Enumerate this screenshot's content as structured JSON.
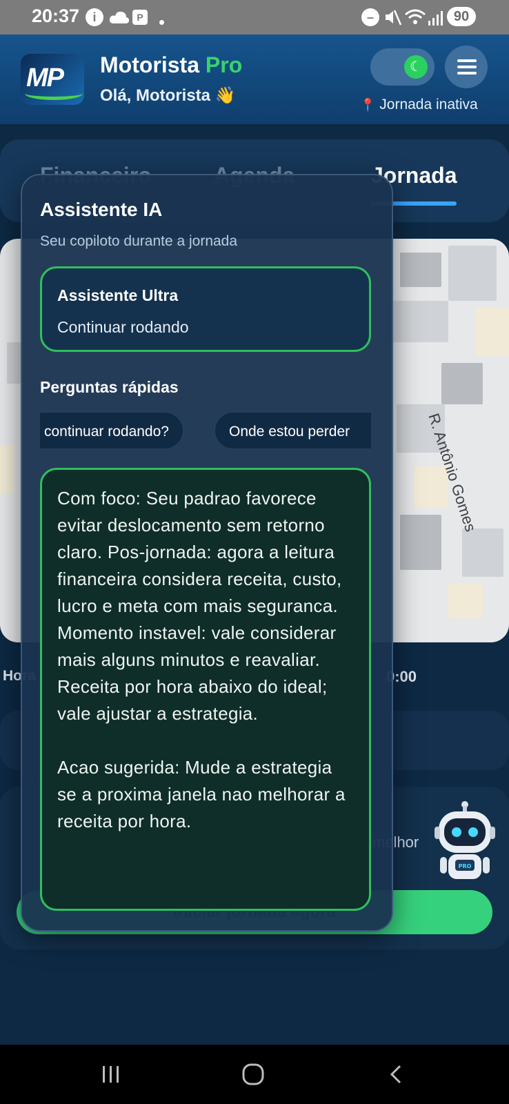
{
  "status_bar": {
    "time": "20:37",
    "battery": "90"
  },
  "header": {
    "app_title": "Motorista",
    "app_title_accent": "Pro",
    "greeting": "Olá, Motorista 👋",
    "logo_text": "MP",
    "jornada_status": "Jornada inativa"
  },
  "tabs": [
    {
      "label": "Financeiro"
    },
    {
      "label": "Agenda"
    },
    {
      "label": "Jornada"
    }
  ],
  "map": {
    "street_label": "R. Antônio Gomes"
  },
  "background": {
    "hora_label": "Hora",
    "time_value": "0:00",
    "card_text": "melhor",
    "start_button": "Iniciar jornada agora"
  },
  "assistant": {
    "title": "Assistente IA",
    "subtitle": "Seu copiloto durante a jornada",
    "ultra_title": "Assistente Ultra",
    "ultra_subtitle": "Continuar rodando",
    "quick_title": "Perguntas rápidas",
    "quick_questions": [
      "continuar rodando?",
      "Onde estou perder"
    ],
    "response_paragraphs": [
      "Com foco: Seu padrao favorece evitar deslocamento sem retorno claro. Pos-jornada: agora a leitura financeira considera receita, custo, lucro e meta com mais seguranca. Momento instavel: vale considerar mais alguns minutos e reavaliar. Receita por hora abaixo do ideal; vale ajustar a estrategia.",
      "Acao sugerida: Mude a estrategia se a proxima janela nao melhorar a receita por hora."
    ]
  },
  "robot": {
    "badge": "PRO"
  },
  "colors": {
    "accent_green": "#37d46d",
    "header_blue": "#16548c",
    "panel_bg": "#193350"
  }
}
